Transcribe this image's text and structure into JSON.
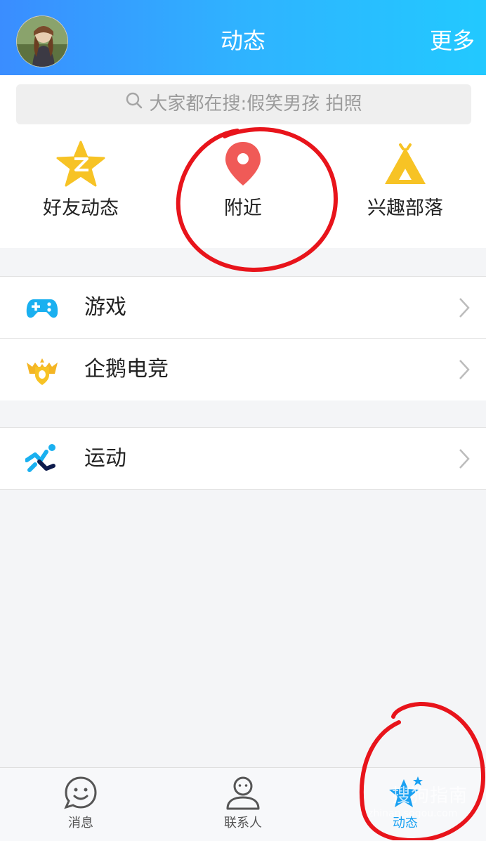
{
  "header": {
    "title": "动态",
    "more": "更多"
  },
  "search": {
    "placeholder": "大家都在搜:假笑男孩 拍照"
  },
  "quick_entries": [
    {
      "label": "好友动态",
      "icon": "star-z-icon"
    },
    {
      "label": "附近",
      "icon": "location-pin-icon"
    },
    {
      "label": "兴趣部落",
      "icon": "tent-icon"
    }
  ],
  "list_group_1": [
    {
      "label": "游戏",
      "icon": "gamepad-icon"
    },
    {
      "label": "企鹅电竞",
      "icon": "esports-badge-icon"
    }
  ],
  "list_group_2": [
    {
      "label": "运动",
      "icon": "running-icon"
    }
  ],
  "tabbar": {
    "items": [
      {
        "label": "消息",
        "icon": "message-bubble-icon",
        "active": false
      },
      {
        "label": "联系人",
        "icon": "contact-person-icon",
        "active": false
      },
      {
        "label": "动态",
        "icon": "star-icon",
        "active": true
      }
    ]
  },
  "watermark": {
    "text": "搜狗指南",
    "subtext": "zhinan.sogou.com"
  },
  "colors": {
    "header_start": "#3a8dff",
    "header_end": "#22c9ff",
    "accent": "#1aa1f2",
    "annotation": "#e8141b"
  }
}
